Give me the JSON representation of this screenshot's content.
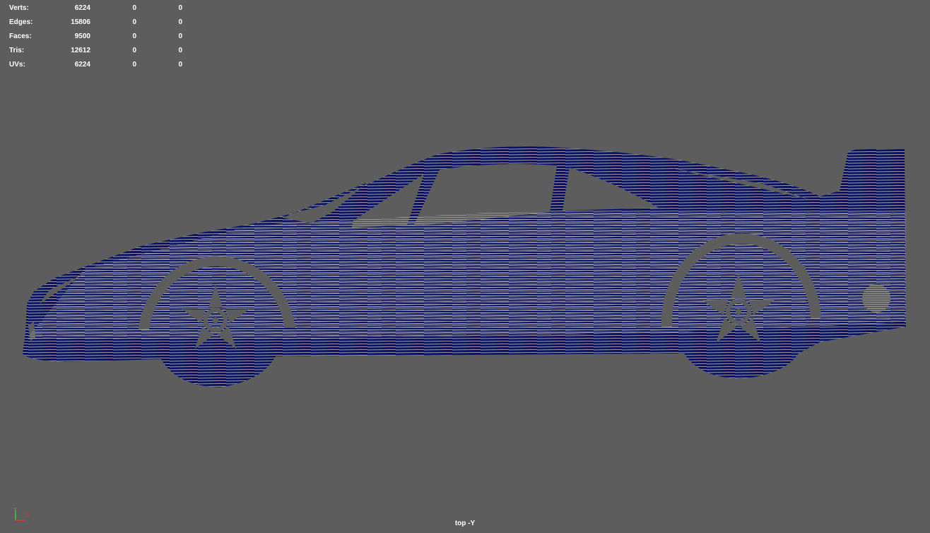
{
  "hud": {
    "rows": [
      {
        "label": "Verts:",
        "v1": "6224",
        "v2": "0",
        "v3": "0"
      },
      {
        "label": "Edges:",
        "v1": "15806",
        "v2": "0",
        "v3": "0"
      },
      {
        "label": "Faces:",
        "v1": "9500",
        "v2": "0",
        "v3": "0"
      },
      {
        "label": "Tris:",
        "v1": "12612",
        "v2": "0",
        "v3": "0"
      },
      {
        "label": "UVs:",
        "v1": "6224",
        "v2": "0",
        "v3": "0"
      }
    ]
  },
  "viewport": {
    "camera_label": "top -Y",
    "background_color": "#5d5d5d",
    "wireframe_color": "#0b0f6e",
    "surface_color": "#a8a8a8"
  },
  "axis_gizmo": {
    "y_label": "Y",
    "x_label": "X",
    "y_color": "#3ec43e",
    "x_color": "#e0352b"
  }
}
